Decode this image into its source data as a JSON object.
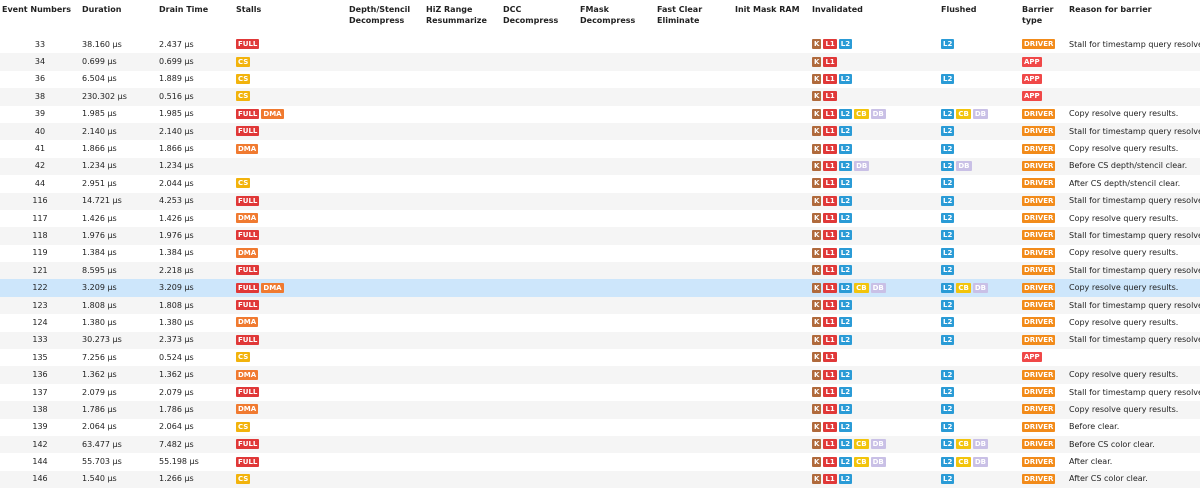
{
  "headers": {
    "event": "Event Numbers",
    "duration": "Duration",
    "drain": "Drain Time",
    "stalls": "Stalls",
    "depth": "Depth/Stencil Decompress",
    "hiz": "HiZ Range Resummarize",
    "dcc": "DCC Decompress",
    "fmask": "FMask Decompress",
    "fastclear": "Fast Clear Eliminate",
    "initmask": "Init Mask RAM",
    "invalidated": "Invalidated",
    "flushed": "Flushed",
    "barrier": "Barrier type",
    "reason": "Reason for barrier"
  },
  "tag_labels": {
    "FULL": "FULL",
    "DMA": "DMA",
    "CS": "CS",
    "K": "K",
    "L1": "L1",
    "L2": "L2",
    "CB": "CB",
    "DB": "DB",
    "DRIVER": "DRIVER",
    "APP": "APP"
  },
  "rows": [
    {
      "event": "33",
      "duration": "38.160 µs",
      "drain": "2.437 µs",
      "stalls": [
        "FULL"
      ],
      "invalidated": [
        "K",
        "L1",
        "L2"
      ],
      "flushed": [
        "L2"
      ],
      "type": "DRIVER",
      "reason": "Stall for timestamp query resolve."
    },
    {
      "event": "34",
      "duration": "0.699 µs",
      "drain": "0.699 µs",
      "stalls": [
        "CS"
      ],
      "invalidated": [
        "K",
        "L1"
      ],
      "flushed": [],
      "type": "APP",
      "reason": ""
    },
    {
      "event": "36",
      "duration": "6.504 µs",
      "drain": "1.889 µs",
      "stalls": [
        "CS"
      ],
      "invalidated": [
        "K",
        "L1",
        "L2"
      ],
      "flushed": [
        "L2"
      ],
      "type": "APP",
      "reason": ""
    },
    {
      "event": "38",
      "duration": "230.302 µs",
      "drain": "0.516 µs",
      "stalls": [
        "CS"
      ],
      "invalidated": [
        "K",
        "L1"
      ],
      "flushed": [],
      "type": "APP",
      "reason": ""
    },
    {
      "event": "39",
      "duration": "1.985 µs",
      "drain": "1.985 µs",
      "stalls": [
        "FULL",
        "DMA"
      ],
      "invalidated": [
        "K",
        "L1",
        "L2",
        "CB",
        "DB"
      ],
      "flushed": [
        "L2",
        "CB",
        "DB"
      ],
      "type": "DRIVER",
      "reason": "Copy resolve query results."
    },
    {
      "event": "40",
      "duration": "2.140 µs",
      "drain": "2.140 µs",
      "stalls": [
        "FULL"
      ],
      "invalidated": [
        "K",
        "L1",
        "L2"
      ],
      "flushed": [
        "L2"
      ],
      "type": "DRIVER",
      "reason": "Stall for timestamp query resolve."
    },
    {
      "event": "41",
      "duration": "1.866 µs",
      "drain": "1.866 µs",
      "stalls": [
        "DMA"
      ],
      "invalidated": [
        "K",
        "L1",
        "L2"
      ],
      "flushed": [
        "L2"
      ],
      "type": "DRIVER",
      "reason": "Copy resolve query results."
    },
    {
      "event": "42",
      "duration": "1.234 µs",
      "drain": "1.234 µs",
      "stalls": [],
      "invalidated": [
        "K",
        "L1",
        "L2",
        "DB"
      ],
      "flushed": [
        "L2",
        "DB"
      ],
      "type": "DRIVER",
      "reason": "Before CS depth/stencil clear."
    },
    {
      "event": "44",
      "duration": "2.951 µs",
      "drain": "2.044 µs",
      "stalls": [
        "CS"
      ],
      "invalidated": [
        "K",
        "L1",
        "L2"
      ],
      "flushed": [
        "L2"
      ],
      "type": "DRIVER",
      "reason": "After CS depth/stencil clear."
    },
    {
      "event": "116",
      "duration": "14.721 µs",
      "drain": "4.253 µs",
      "stalls": [
        "FULL"
      ],
      "invalidated": [
        "K",
        "L1",
        "L2"
      ],
      "flushed": [
        "L2"
      ],
      "type": "DRIVER",
      "reason": "Stall for timestamp query resolve."
    },
    {
      "event": "117",
      "duration": "1.426 µs",
      "drain": "1.426 µs",
      "stalls": [
        "DMA"
      ],
      "invalidated": [
        "K",
        "L1",
        "L2"
      ],
      "flushed": [
        "L2"
      ],
      "type": "DRIVER",
      "reason": "Copy resolve query results."
    },
    {
      "event": "118",
      "duration": "1.976 µs",
      "drain": "1.976 µs",
      "stalls": [
        "FULL"
      ],
      "invalidated": [
        "K",
        "L1",
        "L2"
      ],
      "flushed": [
        "L2"
      ],
      "type": "DRIVER",
      "reason": "Stall for timestamp query resolve."
    },
    {
      "event": "119",
      "duration": "1.384 µs",
      "drain": "1.384 µs",
      "stalls": [
        "DMA"
      ],
      "invalidated": [
        "K",
        "L1",
        "L2"
      ],
      "flushed": [
        "L2"
      ],
      "type": "DRIVER",
      "reason": "Copy resolve query results."
    },
    {
      "event": "121",
      "duration": "8.595 µs",
      "drain": "2.218 µs",
      "stalls": [
        "FULL"
      ],
      "invalidated": [
        "K",
        "L1",
        "L2"
      ],
      "flushed": [
        "L2"
      ],
      "type": "DRIVER",
      "reason": "Stall for timestamp query resolve."
    },
    {
      "event": "122",
      "duration": "3.209 µs",
      "drain": "3.209 µs",
      "stalls": [
        "FULL",
        "DMA"
      ],
      "invalidated": [
        "K",
        "L1",
        "L2",
        "CB",
        "DB"
      ],
      "flushed": [
        "L2",
        "CB",
        "DB"
      ],
      "type": "DRIVER",
      "reason": "Copy resolve query results.",
      "selected": true
    },
    {
      "event": "123",
      "duration": "1.808 µs",
      "drain": "1.808 µs",
      "stalls": [
        "FULL"
      ],
      "invalidated": [
        "K",
        "L1",
        "L2"
      ],
      "flushed": [
        "L2"
      ],
      "type": "DRIVER",
      "reason": "Stall for timestamp query resolve."
    },
    {
      "event": "124",
      "duration": "1.380 µs",
      "drain": "1.380 µs",
      "stalls": [
        "DMA"
      ],
      "invalidated": [
        "K",
        "L1",
        "L2"
      ],
      "flushed": [
        "L2"
      ],
      "type": "DRIVER",
      "reason": "Copy resolve query results."
    },
    {
      "event": "133",
      "duration": "30.273 µs",
      "drain": "2.373 µs",
      "stalls": [
        "FULL"
      ],
      "invalidated": [
        "K",
        "L1",
        "L2"
      ],
      "flushed": [
        "L2"
      ],
      "type": "DRIVER",
      "reason": "Stall for timestamp query resolve."
    },
    {
      "event": "135",
      "duration": "7.256 µs",
      "drain": "0.524 µs",
      "stalls": [
        "CS"
      ],
      "invalidated": [
        "K",
        "L1"
      ],
      "flushed": [],
      "type": "APP",
      "reason": ""
    },
    {
      "event": "136",
      "duration": "1.362 µs",
      "drain": "1.362 µs",
      "stalls": [
        "DMA"
      ],
      "invalidated": [
        "K",
        "L1",
        "L2"
      ],
      "flushed": [
        "L2"
      ],
      "type": "DRIVER",
      "reason": "Copy resolve query results."
    },
    {
      "event": "137",
      "duration": "2.079 µs",
      "drain": "2.079 µs",
      "stalls": [
        "FULL"
      ],
      "invalidated": [
        "K",
        "L1",
        "L2"
      ],
      "flushed": [
        "L2"
      ],
      "type": "DRIVER",
      "reason": "Stall for timestamp query resolve."
    },
    {
      "event": "138",
      "duration": "1.786 µs",
      "drain": "1.786 µs",
      "stalls": [
        "DMA"
      ],
      "invalidated": [
        "K",
        "L1",
        "L2"
      ],
      "flushed": [
        "L2"
      ],
      "type": "DRIVER",
      "reason": "Copy resolve query results."
    },
    {
      "event": "139",
      "duration": "2.064 µs",
      "drain": "2.064 µs",
      "stalls": [
        "CS"
      ],
      "invalidated": [
        "K",
        "L1",
        "L2"
      ],
      "flushed": [
        "L2"
      ],
      "type": "DRIVER",
      "reason": "Before clear."
    },
    {
      "event": "142",
      "duration": "63.477 µs",
      "drain": "7.482 µs",
      "stalls": [
        "FULL"
      ],
      "invalidated": [
        "K",
        "L1",
        "L2",
        "CB",
        "DB"
      ],
      "flushed": [
        "L2",
        "CB",
        "DB"
      ],
      "type": "DRIVER",
      "reason": "Before CS color clear."
    },
    {
      "event": "144",
      "duration": "55.703 µs",
      "drain": "55.198 µs",
      "stalls": [
        "FULL"
      ],
      "invalidated": [
        "K",
        "L1",
        "L2",
        "CB",
        "DB"
      ],
      "flushed": [
        "L2",
        "CB",
        "DB"
      ],
      "type": "DRIVER",
      "reason": "After clear."
    },
    {
      "event": "146",
      "duration": "1.540 µs",
      "drain": "1.266 µs",
      "stalls": [
        "CS"
      ],
      "invalidated": [
        "K",
        "L1",
        "L2"
      ],
      "flushed": [
        "L2"
      ],
      "type": "DRIVER",
      "reason": "After CS color clear."
    }
  ],
  "colors": {
    "selected_row": "#cde6fb",
    "alt_row": "#f5f5f5",
    "FULL": "#e03838",
    "DMA": "#f07a30",
    "CS": "#f2b30c",
    "K": "#b06a3c",
    "L1": "#e03838",
    "L2": "#2a9bd6",
    "CB": "#f2c40c",
    "DB": "#c9c0e6",
    "DRIVER": "#f28b1a",
    "APP": "#f04848"
  }
}
